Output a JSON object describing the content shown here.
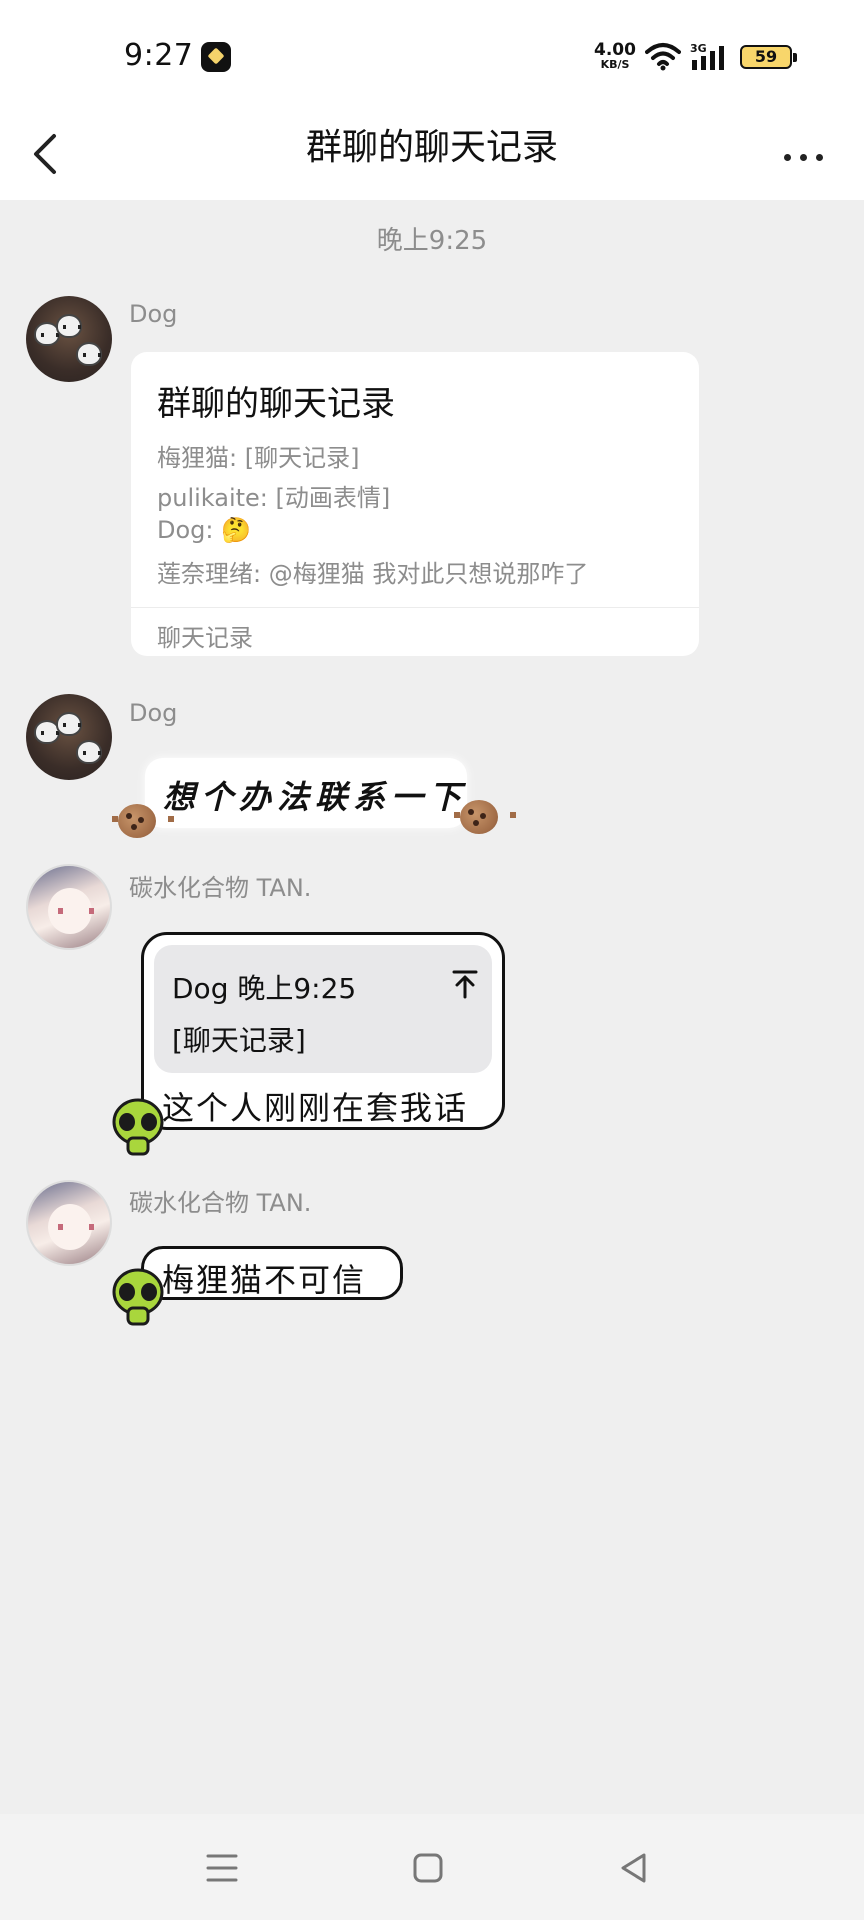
{
  "status_bar": {
    "time": "9:27",
    "net_speed_value": "4.00",
    "net_speed_unit": "KB/S",
    "network_type": "3G",
    "battery": "59"
  },
  "header": {
    "title": "群聊的聊天记录"
  },
  "chat": {
    "timestamp": "晚上9:25",
    "messages": [
      {
        "sender": "Dog",
        "card": {
          "title": "群聊的聊天记录",
          "lines": [
            "梅狸猫: [聊天记录]",
            "pulikaite: [动画表情]",
            "Dog: 🤔",
            "莲奈理绪: @梅狸猫 我对此只想说那咋了"
          ],
          "footer": "聊天记录"
        }
      },
      {
        "sender": "Dog",
        "text": "想个办法联系一下"
      },
      {
        "sender": "碳水化合物 TAN.",
        "reply": {
          "meta": "Dog 晚上9:25",
          "quoted": "[聊天记录]"
        },
        "text": "这个人刚刚在套我话"
      },
      {
        "sender": "碳水化合物 TAN.",
        "text": "梅狸猫不可信"
      }
    ]
  },
  "colors": {
    "background": "#efefef",
    "secondary_text": "#8d8d8d",
    "alien_green": "#a9d63c"
  }
}
